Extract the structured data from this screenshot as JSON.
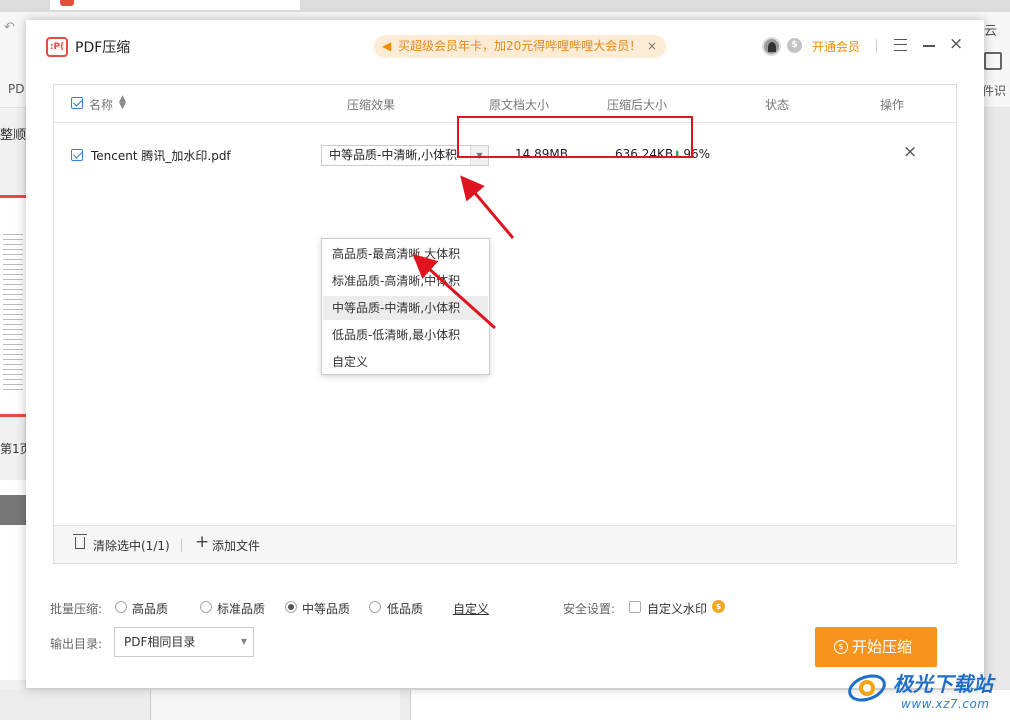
{
  "background_app": {
    "left_toolbar_label": "PD",
    "cloud_label": "云",
    "ocr_label": "件识",
    "sort_label": "整顺",
    "page_label": "第1页"
  },
  "dialog": {
    "title": "PDF压缩",
    "logo_text": ":P(",
    "promo_text": "买超级会员年卡，加20元得哔哩哔哩大会员！",
    "promo_close": "×",
    "vip_link": "开通会员",
    "close_glyph": "×"
  },
  "table": {
    "headers": {
      "name": "名称",
      "effect": "压缩效果",
      "orig_size": "原文档大小",
      "compressed_size": "压缩后大小",
      "status": "状态",
      "action": "操作"
    },
    "rows": [
      {
        "name": "Tencent 腾讯_加水印.pdf",
        "quality": "中等品质-中清晰,小体积",
        "orig_size": "14.89MB",
        "compressed_size": "636.24KB",
        "ratio": "96%",
        "remove_glyph": "×"
      }
    ],
    "dropdown_options": [
      "高品质-最高清晰,大体积",
      "标准品质-高清晰,中体积",
      "中等品质-中清晰,小体积",
      "低品质-低清晰,最小体积",
      "自定义"
    ],
    "dropdown_selected_index": 2,
    "footer": {
      "clear_label": "清除选中(1/1)",
      "add_label": "添加文件"
    }
  },
  "settings": {
    "batch_label": "批量压缩:",
    "batch_options": [
      "高品质",
      "标准品质",
      "中等品质",
      "低品质"
    ],
    "batch_selected": "中等品质",
    "custom_link": "自定义",
    "security_label": "安全设置:",
    "custom_watermark_label": "自定义水印",
    "output_label": "输出目录:",
    "output_value": "PDF相同目录",
    "start_button": "开始压缩"
  },
  "watermark": {
    "main": "极光下载站",
    "url": "www.xz7.com"
  },
  "colors": {
    "accent_orange": "#f7941d",
    "highlight_red": "#e0141e",
    "checkbox_blue": "#3a7bd5"
  }
}
